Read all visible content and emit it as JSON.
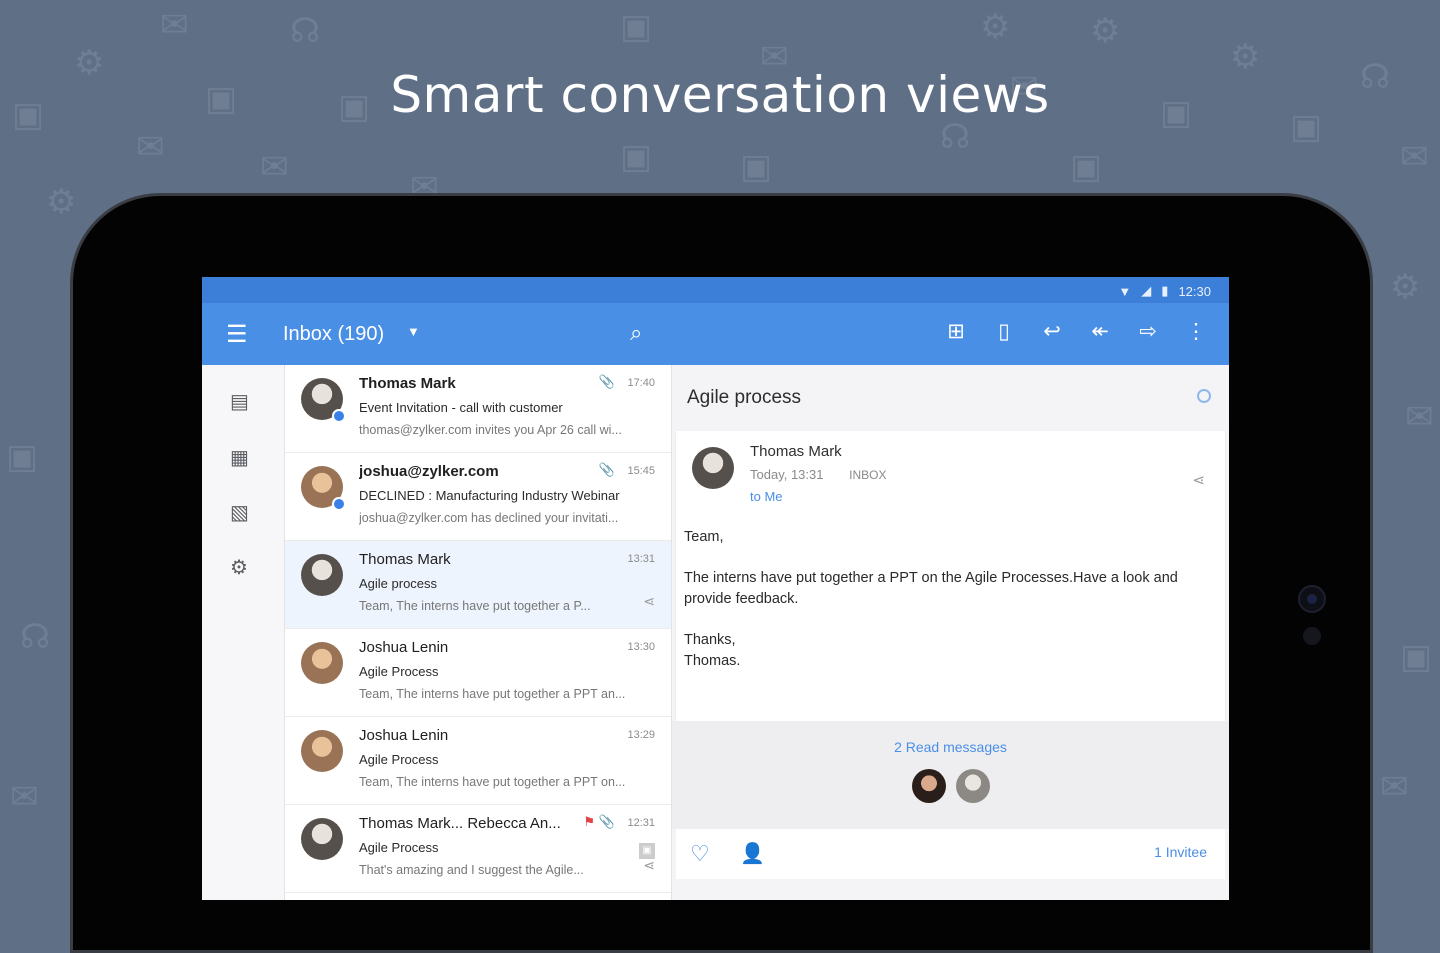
{
  "headline": "Smart conversation views",
  "status_bar": {
    "time": "12:30",
    "icons": [
      "wifi-icon",
      "signal-icon",
      "battery-icon"
    ]
  },
  "app_bar": {
    "menu_icon": "hamburger-menu-icon",
    "folder_title": "Inbox (190)",
    "dropdown_icon": "caret-down-icon",
    "search_icon": "search-icon",
    "actions": [
      "archive-icon",
      "delete-icon",
      "reply-icon",
      "reply-all-icon",
      "forward-icon",
      "more-vert-icon"
    ]
  },
  "nav_rail": [
    "contacts-icon",
    "calendar-icon",
    "notes-icon",
    "settings-icon"
  ],
  "messages": [
    {
      "from": "Thomas Mark",
      "subject": "Event Invitation - call with customer",
      "preview": "thomas@zylker.com invites you Apr 26 call wi...",
      "time": "17:40",
      "unread": true,
      "attachment": true,
      "avatar_initials": "TM"
    },
    {
      "from": "joshua@zylker.com",
      "subject": "DECLINED : Manufacturing Industry Webinar",
      "preview": "joshua@zylker.com has declined your invitati...",
      "time": "15:45",
      "unread": true,
      "attachment": true,
      "avatar_initials": "JL"
    },
    {
      "from": "Thomas Mark",
      "subject": "Agile process",
      "preview": "Team, The interns have put together a P...",
      "time": "13:31",
      "selected": true,
      "avatar_initials": "TM"
    },
    {
      "from": "Joshua Lenin",
      "subject": "Agile Process",
      "preview": "Team, The interns have put together a PPT an...",
      "time": "13:30",
      "avatar_initials": "JL"
    },
    {
      "from": "Joshua Lenin",
      "subject": "Agile Process",
      "preview": "Team, The interns have put together a PPT on...",
      "time": "13:29",
      "avatar_initials": "JL"
    },
    {
      "from": "Thomas Mark... Rebecca An...",
      "subject": "Agile Process",
      "preview": "That's amazing and I suggest the Agile...",
      "time": "12:31",
      "flagged": true,
      "attachment": true,
      "avatar_initials": "TM"
    }
  ],
  "detail": {
    "subject": "Agile process",
    "sender": "Thomas Mark",
    "date": "Today, 13:31",
    "folder": "INBOX",
    "to": "to Me",
    "body": [
      "Team,",
      "The interns have put together a PPT on the Agile Processes.Have a look and provide feedback.",
      "Thanks,",
      "Thomas."
    ],
    "read_messages": "2 Read messages",
    "invitee": "1 Invitee"
  },
  "colors": {
    "background": "#5f6f86",
    "app_bar": "#4a8fe6",
    "status_bar": "#3b7fd9",
    "accent": "#4a8fe6",
    "unread_dot": "#3b80e8"
  }
}
